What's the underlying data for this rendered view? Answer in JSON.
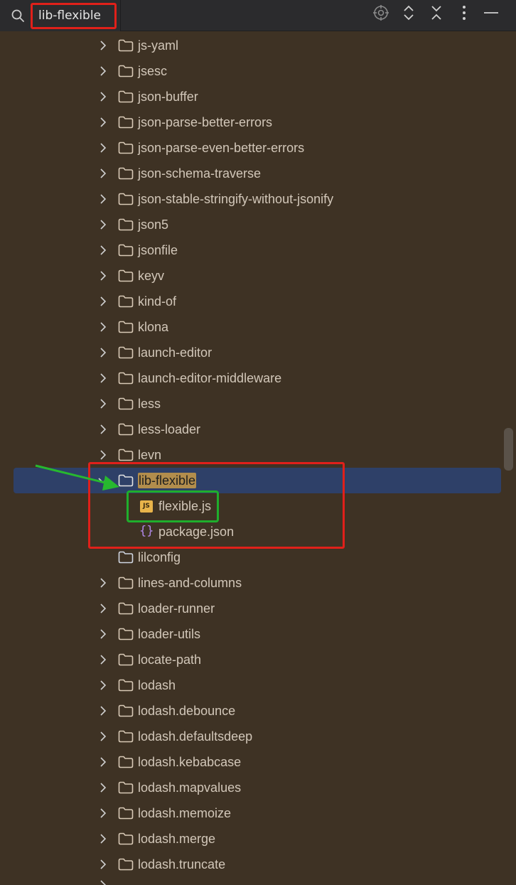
{
  "search": {
    "query": "lib-flexible"
  },
  "toolbar": {
    "buttons": [
      {
        "icon": "crosshair-icon"
      },
      {
        "icon": "expand-all-icon"
      },
      {
        "icon": "collapse-all-icon"
      },
      {
        "icon": "more-options-icon"
      },
      {
        "icon": "minimize-icon"
      }
    ]
  },
  "tree": {
    "items": [
      {
        "label": "js-yaml",
        "type": "folder"
      },
      {
        "label": "jsesc",
        "type": "folder"
      },
      {
        "label": "json-buffer",
        "type": "folder"
      },
      {
        "label": "json-parse-better-errors",
        "type": "folder"
      },
      {
        "label": "json-parse-even-better-errors",
        "type": "folder"
      },
      {
        "label": "json-schema-traverse",
        "type": "folder"
      },
      {
        "label": "json-stable-stringify-without-jsonify",
        "type": "folder"
      },
      {
        "label": "json5",
        "type": "folder"
      },
      {
        "label": "jsonfile",
        "type": "folder"
      },
      {
        "label": "keyv",
        "type": "folder"
      },
      {
        "label": "kind-of",
        "type": "folder"
      },
      {
        "label": "klona",
        "type": "folder"
      },
      {
        "label": "launch-editor",
        "type": "folder"
      },
      {
        "label": "launch-editor-middleware",
        "type": "folder"
      },
      {
        "label": "less",
        "type": "folder"
      },
      {
        "label": "less-loader",
        "type": "folder"
      },
      {
        "label": "levn",
        "type": "folder"
      },
      {
        "label": "lib-flexible",
        "type": "folder-open"
      },
      {
        "label": "flexible.js",
        "type": "js"
      },
      {
        "label": "package.json",
        "type": "json"
      },
      {
        "label": "lilconfig",
        "type": "folder"
      },
      {
        "label": "lines-and-columns",
        "type": "folder"
      },
      {
        "label": "loader-runner",
        "type": "folder"
      },
      {
        "label": "loader-utils",
        "type": "folder"
      },
      {
        "label": "locate-path",
        "type": "folder"
      },
      {
        "label": "lodash",
        "type": "folder"
      },
      {
        "label": "lodash.debounce",
        "type": "folder"
      },
      {
        "label": "lodash.defaultsdeep",
        "type": "folder"
      },
      {
        "label": "lodash.kebabcase",
        "type": "folder"
      },
      {
        "label": "lodash.mapvalues",
        "type": "folder"
      },
      {
        "label": "lodash.memoize",
        "type": "folder"
      },
      {
        "label": "lodash.merge",
        "type": "folder"
      },
      {
        "label": "lodash.truncate",
        "type": "folder"
      }
    ]
  },
  "colors": {
    "background": "#3e3224",
    "selection": "#2e4068",
    "match_highlight": "#b28d4c",
    "annotation_red": "#e0201a",
    "annotation_green": "#1fae2c"
  }
}
